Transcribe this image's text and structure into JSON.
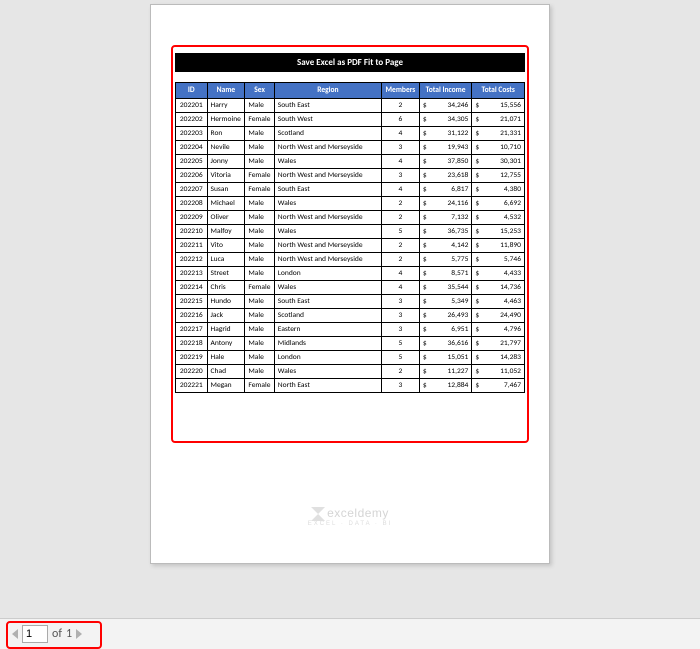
{
  "title": "Save Excel as PDF Fit to Page",
  "headers": [
    "ID",
    "Name",
    "Sex",
    "Region",
    "Members",
    "Total Income",
    "Total Costs"
  ],
  "currency": "$",
  "rows": [
    {
      "id": "202201",
      "name": "Harry",
      "sex": "Male",
      "region": "South East",
      "members": "2",
      "income": "34,246",
      "costs": "15,556"
    },
    {
      "id": "202202",
      "name": "Hermoine",
      "sex": "Female",
      "region": "South West",
      "members": "6",
      "income": "34,305",
      "costs": "21,071"
    },
    {
      "id": "202203",
      "name": "Ron",
      "sex": "Male",
      "region": "Scotland",
      "members": "4",
      "income": "31,122",
      "costs": "21,331"
    },
    {
      "id": "202204",
      "name": "Nevile",
      "sex": "Male",
      "region": "North West and Merseyside",
      "members": "3",
      "income": "19,943",
      "costs": "10,710"
    },
    {
      "id": "202205",
      "name": "Jonny",
      "sex": "Male",
      "region": "Wales",
      "members": "4",
      "income": "37,850",
      "costs": "30,301"
    },
    {
      "id": "202206",
      "name": "Vitoria",
      "sex": "Female",
      "region": "North West and Merseyside",
      "members": "3",
      "income": "23,618",
      "costs": "12,755"
    },
    {
      "id": "202207",
      "name": "Susan",
      "sex": "Female",
      "region": "South East",
      "members": "4",
      "income": "6,817",
      "costs": "4,380"
    },
    {
      "id": "202208",
      "name": "Michael",
      "sex": "Male",
      "region": "Wales",
      "members": "2",
      "income": "24,116",
      "costs": "6,692"
    },
    {
      "id": "202209",
      "name": "Oliver",
      "sex": "Male",
      "region": "North West and Merseyside",
      "members": "2",
      "income": "7,132",
      "costs": "4,532"
    },
    {
      "id": "202210",
      "name": "Malfoy",
      "sex": "Male",
      "region": "Wales",
      "members": "5",
      "income": "36,735",
      "costs": "15,253"
    },
    {
      "id": "202211",
      "name": "Vito",
      "sex": "Male",
      "region": "North West and Merseyside",
      "members": "2",
      "income": "4,142",
      "costs": "11,890"
    },
    {
      "id": "202212",
      "name": "Luca",
      "sex": "Male",
      "region": "North West and Merseyside",
      "members": "2",
      "income": "5,775",
      "costs": "5,746"
    },
    {
      "id": "202213",
      "name": "Street",
      "sex": "Male",
      "region": "London",
      "members": "4",
      "income": "8,571",
      "costs": "4,433"
    },
    {
      "id": "202214",
      "name": "Chris",
      "sex": "Female",
      "region": "Wales",
      "members": "4",
      "income": "35,544",
      "costs": "14,736"
    },
    {
      "id": "202215",
      "name": "Hundo",
      "sex": "Male",
      "region": "South East",
      "members": "3",
      "income": "5,349",
      "costs": "4,463"
    },
    {
      "id": "202216",
      "name": "Jack",
      "sex": "Male",
      "region": "Scotland",
      "members": "3",
      "income": "26,493",
      "costs": "24,490"
    },
    {
      "id": "202217",
      "name": "Hagrid",
      "sex": "Male",
      "region": "Eastern",
      "members": "3",
      "income": "6,951",
      "costs": "4,796"
    },
    {
      "id": "202218",
      "name": "Antony",
      "sex": "Male",
      "region": "Midlands",
      "members": "5",
      "income": "36,616",
      "costs": "21,797"
    },
    {
      "id": "202219",
      "name": "Hale",
      "sex": "Male",
      "region": "London",
      "members": "5",
      "income": "15,051",
      "costs": "14,283"
    },
    {
      "id": "202220",
      "name": "Chad",
      "sex": "Male",
      "region": "Wales",
      "members": "2",
      "income": "11,227",
      "costs": "11,052"
    },
    {
      "id": "202221",
      "name": "Megan",
      "sex": "Female",
      "region": "North East",
      "members": "3",
      "income": "12,884",
      "costs": "7,467"
    }
  ],
  "watermark": {
    "brand": "exceldemy",
    "tagline": "EXCEL · DATA · BI"
  },
  "pager": {
    "current": "1",
    "of_label": "of",
    "total": "1"
  }
}
